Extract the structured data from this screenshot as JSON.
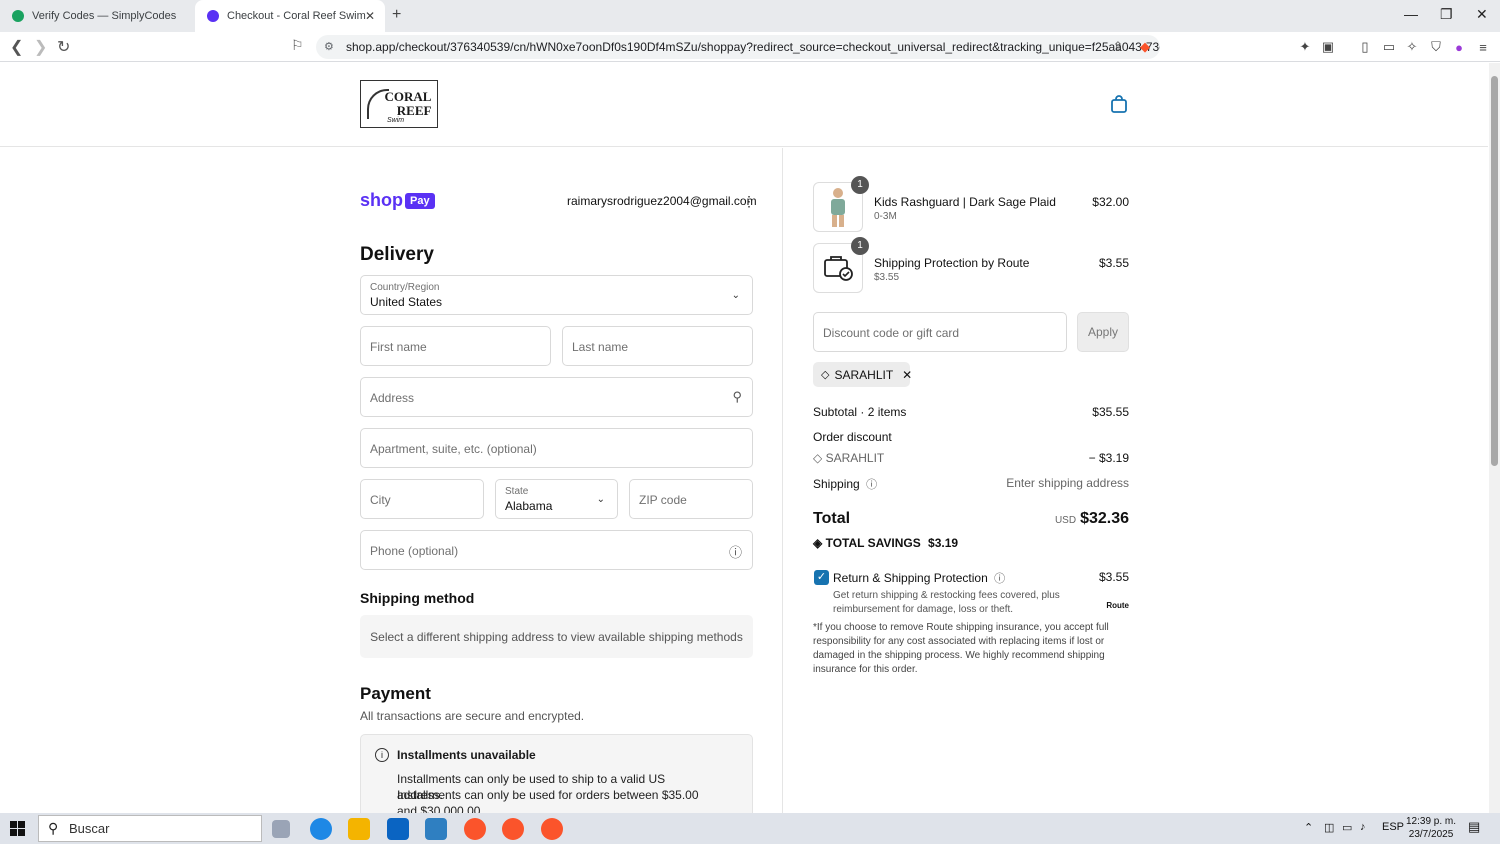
{
  "browser": {
    "tabs": [
      {
        "title": "Verify Codes — SimplyCodes",
        "active": false,
        "favicon_color": "#1aa260"
      },
      {
        "title": "Checkout - Coral Reef Swim",
        "active": true,
        "favicon_color": "#5a31f4"
      }
    ],
    "url": "shop.app/checkout/376340539/cn/hWN0xe7oonDf0s190Df4mSZu/shoppay?redirect_source=checkout_universal_redirect&tracking_unique=f25aa043-73e..."
  },
  "store": {
    "logo_line1": "CORAL",
    "logo_line2": "REEF",
    "logo_sub": "Swim"
  },
  "account": {
    "email": "raimarysrodriguez2004@gmail.com",
    "shop": "shop",
    "pay": "Pay"
  },
  "delivery": {
    "heading": "Delivery",
    "country_label": "Country/Region",
    "country_value": "United States",
    "first_name_ph": "First name",
    "last_name_ph": "Last name",
    "address_ph": "Address",
    "apartment_ph": "Apartment, suite, etc. (optional)",
    "city_ph": "City",
    "state_label": "State",
    "state_value": "Alabama",
    "zip_ph": "ZIP code",
    "phone_ph": "Phone (optional)"
  },
  "shipping_method": {
    "heading": "Shipping method",
    "message": "Select a different shipping address to view available shipping methods"
  },
  "payment": {
    "heading": "Payment",
    "note": "All transactions are secure and encrypted.",
    "installments_title": "Installments unavailable",
    "installments_line1": "Installments can only be used to ship to a valid US address.",
    "installments_line2": "Installments can only be used for orders between $35.00 and $30,000.00"
  },
  "order": {
    "items": [
      {
        "name": "Kids Rashguard | Dark Sage Plaid",
        "variant": "0-3M",
        "price": "$32.00",
        "qty": "1"
      },
      {
        "name": "Shipping Protection by Route",
        "variant": "$3.55",
        "price": "$3.55",
        "qty": "1"
      }
    ],
    "discount_ph": "Discount code or gift card",
    "apply_label": "Apply",
    "applied_code": "SARAHLIT",
    "subtotal_label": "Subtotal · 2 items",
    "subtotal_value": "$35.55",
    "order_discount_label": "Order discount",
    "discount_code": "SARAHLIT",
    "discount_value": "− $3.19",
    "shipping_label": "Shipping",
    "shipping_value": "Enter shipping address",
    "total_label": "Total",
    "currency": "USD",
    "total_value": "$32.36",
    "savings_label": "TOTAL SAVINGS",
    "savings_value": "$3.19",
    "protection_label": "Return & Shipping Protection",
    "protection_price": "$3.55",
    "protection_desc": "Get return shipping & restocking fees covered, plus reimbursement for damage, loss or theft.",
    "route_logo": "Route",
    "disclaimer": "*If you choose to remove Route shipping insurance, you accept full responsibility for any cost associated with replacing items if lost or damaged in the shipping process. We highly recommend shipping insurance for this order."
  },
  "taskbar": {
    "search_ph": "Buscar",
    "lang": "ESP",
    "time": "12:39 p. m.",
    "date": "23/7/2025"
  },
  "colors": {
    "shop_purple": "#5a31f4",
    "checkbox_blue": "#1773b0"
  }
}
